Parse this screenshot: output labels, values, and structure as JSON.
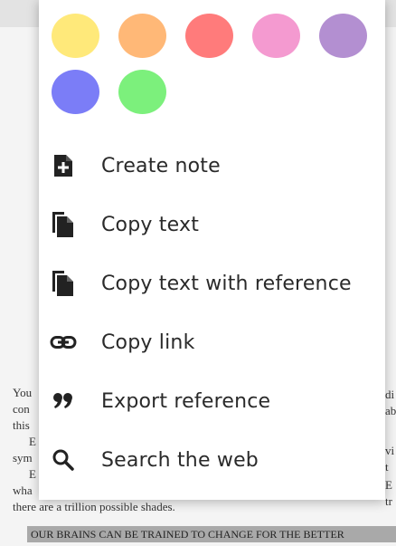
{
  "document": {
    "lines": [
      {
        "text": "You",
        "indent": false
      },
      {
        "text": "con",
        "indent": false
      },
      {
        "text": "this",
        "indent": false
      },
      {
        "text": "E",
        "indent": true
      },
      {
        "text": "sym",
        "indent": false
      },
      {
        "text": "E",
        "indent": true
      },
      {
        "text": "wha",
        "indent": false
      },
      {
        "text": "there are a trillion possible shades.",
        "indent": false
      }
    ],
    "heading": "OUR BRAINS CAN BE TRAINED TO CHANGE FOR THE BETTER",
    "right_edge": [
      "di",
      "ab",
      "",
      "vi",
      "t ",
      "E",
      "tr"
    ]
  },
  "menu": {
    "swatches": [
      {
        "name": "yellow",
        "color": "#ffe97a"
      },
      {
        "name": "orange",
        "color": "#ffb877"
      },
      {
        "name": "red",
        "color": "#ff7b7b"
      },
      {
        "name": "pink",
        "color": "#f49ad0"
      },
      {
        "name": "purple",
        "color": "#b38fd1"
      },
      {
        "name": "blue",
        "color": "#7b7df7"
      },
      {
        "name": "green",
        "color": "#7cf07c"
      }
    ],
    "items": [
      {
        "id": "create-note",
        "label": "Create note",
        "icon": "note-plus-icon"
      },
      {
        "id": "copy-text",
        "label": "Copy text",
        "icon": "copy-icon"
      },
      {
        "id": "copy-text-with-reference",
        "label": "Copy text with reference",
        "icon": "copy-reference-icon"
      },
      {
        "id": "copy-link",
        "label": "Copy link",
        "icon": "link-icon"
      },
      {
        "id": "export-reference",
        "label": "Export reference",
        "icon": "quote-icon"
      },
      {
        "id": "search-the-web",
        "label": "Search the web",
        "icon": "search-icon"
      }
    ]
  }
}
